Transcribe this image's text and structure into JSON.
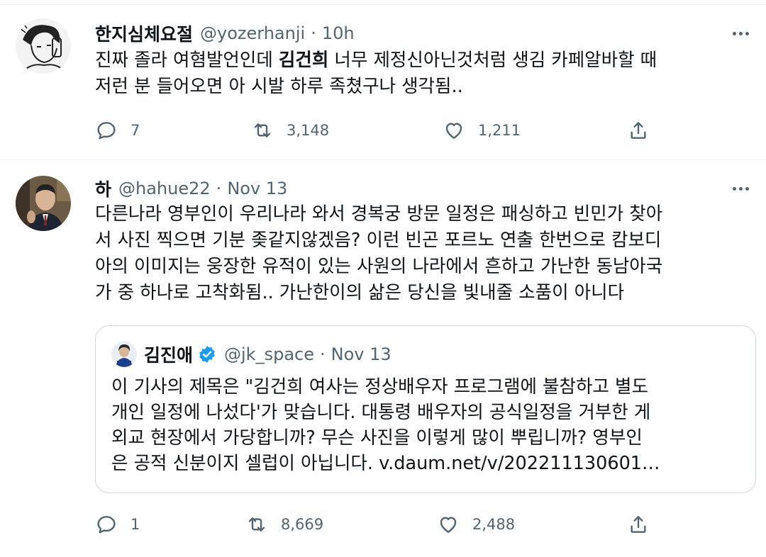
{
  "tweets": [
    {
      "display_name": "한지심체요절",
      "handle": "@yozerhanji",
      "separator": "·",
      "time": "10h",
      "text_parts": {
        "line1_pre": "진짜 졸라 여혐발언인데 ",
        "line1_bold": "김건희",
        "line1_post": " 너무 제정신아닌것처럼 생김 카페알바할 때",
        "line2": "저런 분 들어오면 아 시발 하루 족쳤구나 생각됨.."
      },
      "stats": {
        "replies": "7",
        "retweets": "3,148",
        "likes": "1,211"
      }
    },
    {
      "display_name": "하",
      "handle": "@hahue22",
      "separator": "·",
      "time": "Nov 13",
      "lines": [
        "다른나라 영부인이 우리나라 와서 경복궁 방문 일정은 패싱하고 빈민가 찾아",
        "서 사진 찍으면 기분 좆같지않겠음? 이런 빈곤 포르노 연출 한번으로 캄보디",
        "아의 이미지는 웅장한 유적이 있는 사원의 나라에서 흔하고 가난한 동남아국",
        "가 중 하나로 고착화됨.. 가난한이의 삶은 당신을 빛내줄 소품이 아니다"
      ],
      "quote": {
        "display_name": "김진애",
        "handle": "@jk_space",
        "separator": "·",
        "time": "Nov 13",
        "lines": [
          "이 기사의 제목은 \"김건희 여사는 정상배우자 프로그램에 불참하고 별도",
          "개인 일정에 나섰다'가 맞습니다. 대통령 배우자의 공식일정을 거부한 게",
          "외교 현장에서 가당합니까? 무슨 사진을 이렇게 많이 뿌립니까? 영부인",
          "은 공적 신분이지 셀럽이 아닙니다. v.daum.net/v/202211130601…"
        ]
      },
      "stats": {
        "replies": "1",
        "retweets": "8,669",
        "likes": "2,488"
      }
    }
  ],
  "icons": {
    "reply": "reply-icon",
    "retweet": "retweet-icon",
    "like": "like-icon",
    "share": "share-icon",
    "more": "more-icon",
    "verified": "verified-badge-icon"
  },
  "colors": {
    "text_primary": "#0f1419",
    "text_secondary": "#536471",
    "verified_blue": "#1d9bf0",
    "border": "#cfd9de"
  }
}
